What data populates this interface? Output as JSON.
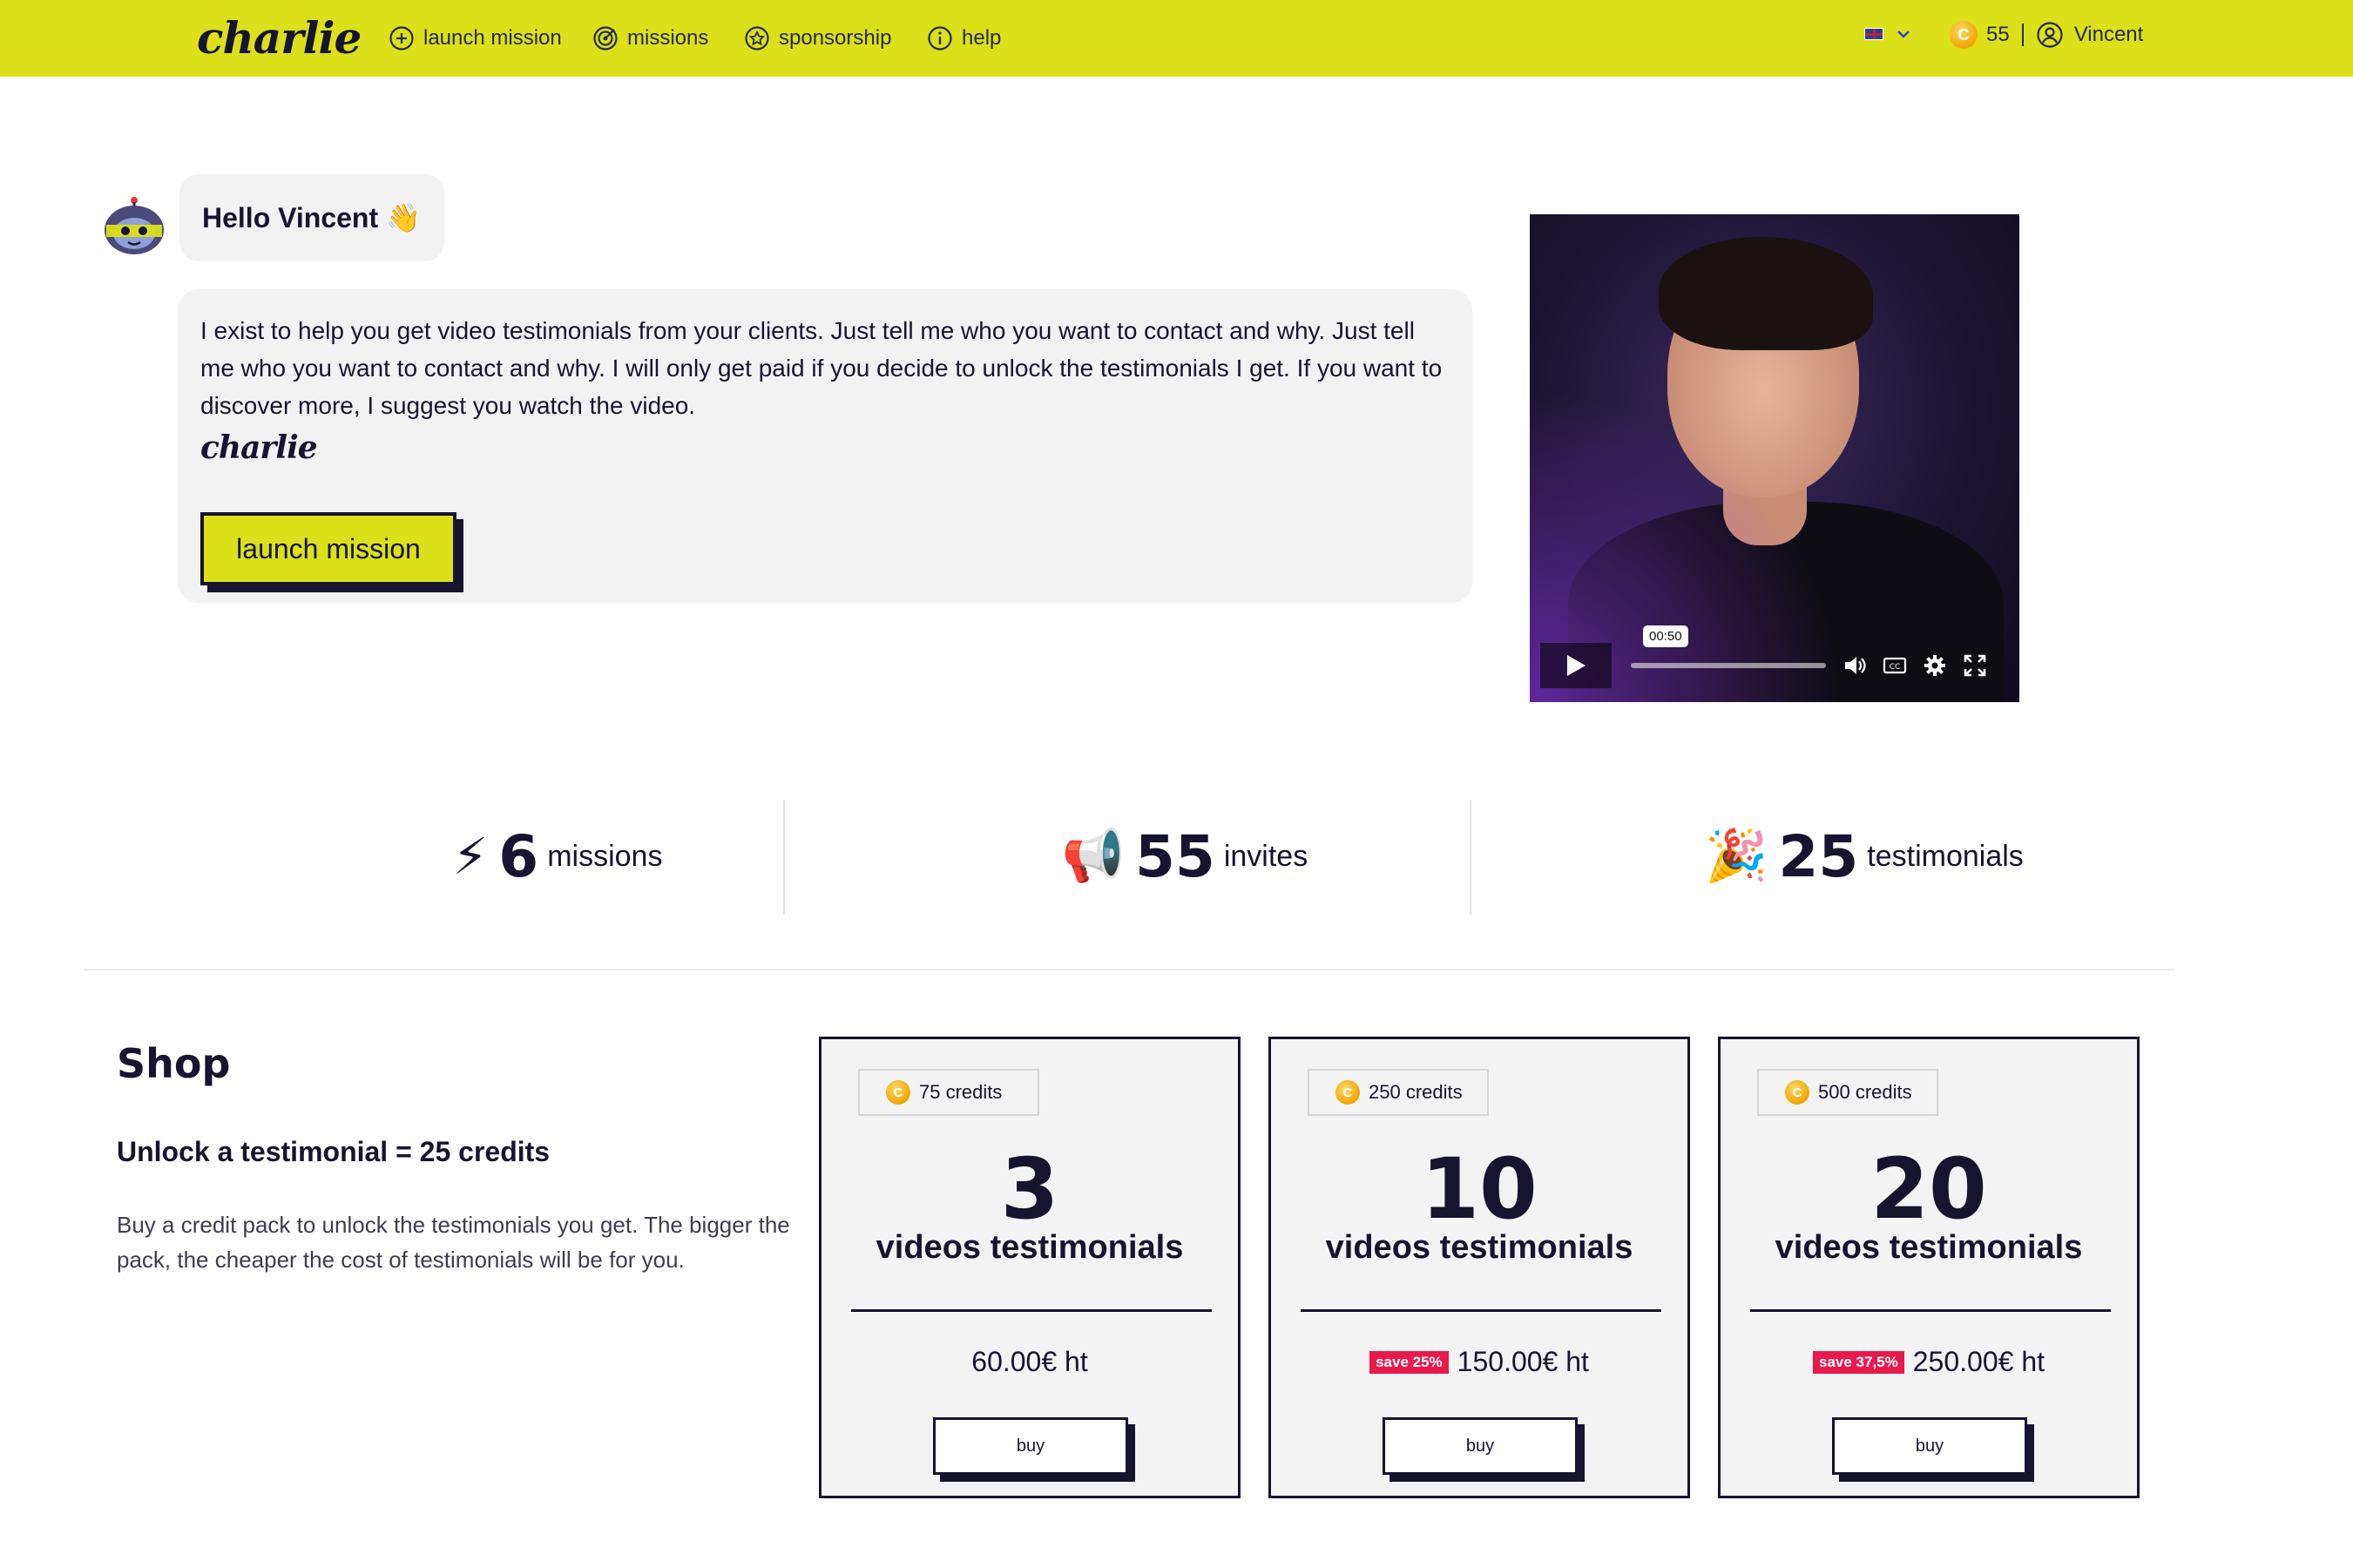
{
  "header": {
    "logo": "charlie",
    "nav": [
      {
        "label": "launch mission",
        "icon": "plus-circle-icon"
      },
      {
        "label": "missions",
        "icon": "target-icon"
      },
      {
        "label": "sponsorship",
        "icon": "star-badge-icon"
      },
      {
        "label": "help",
        "icon": "info-icon"
      }
    ],
    "language_icon": "uk-flag-icon",
    "credits": "55",
    "user_name": "Vincent"
  },
  "greeting": {
    "hello": "Hello Vincent 👋",
    "message": "I exist to help you get video testimonials from your clients. Just tell me who you want to contact and why. Just tell me who you want to contact and why. I will only get paid if you decide to unlock the testimonials I get. If you want to discover more, I suggest you watch the video.",
    "signature": "charlie",
    "cta": "launch mission"
  },
  "video": {
    "time_tooltip": "00:50",
    "progress_fraction": 0.0
  },
  "stats": [
    {
      "emoji": "⚡",
      "value": "6",
      "label": "missions"
    },
    {
      "emoji": "📢",
      "value": "55",
      "label": "invites"
    },
    {
      "emoji": "🎉",
      "value": "25",
      "label": "testimonials"
    }
  ],
  "shop": {
    "title": "Shop",
    "subtitle": "Unlock a testimonial = 25 credits",
    "description": "Buy a credit pack to unlock the testimonials you get. The bigger the pack, the cheaper the cost of testimonials will be for you.",
    "packs": [
      {
        "credits": "75 credits",
        "count": "3",
        "unit": "videos testimonials",
        "save": "",
        "price": "60.00€ ht",
        "buy": "buy"
      },
      {
        "credits": "250 credits",
        "count": "10",
        "unit": "videos testimonials",
        "save": "save 25%",
        "price": "150.00€ ht",
        "buy": "buy"
      },
      {
        "credits": "500 credits",
        "count": "20",
        "unit": "videos testimonials",
        "save": "save 37,5%",
        "price": "250.00€ ht",
        "buy": "buy"
      }
    ]
  },
  "colors": {
    "accent": "#dbe01b",
    "ink": "#16142e",
    "save_badge": "#e8194b"
  }
}
